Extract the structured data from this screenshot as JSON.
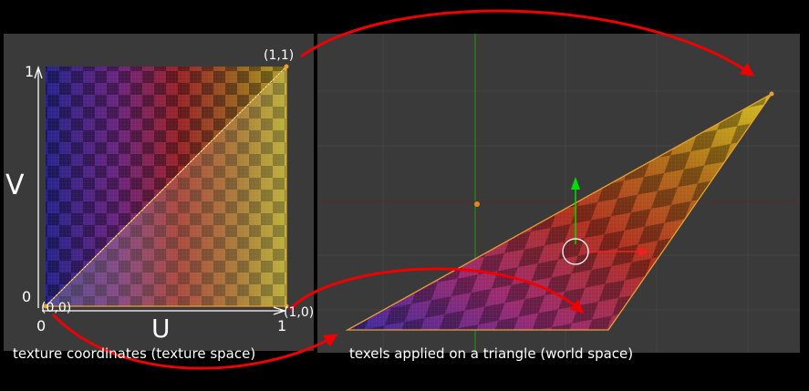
{
  "left_panel": {
    "axis_v_label": "V",
    "axis_u_label": "U",
    "tick_v_top": "1",
    "tick_v_bottom": "0",
    "tick_u_left": "0",
    "tick_u_right": "1",
    "coord_origin": "(0,0)",
    "coord_top_right": "(1,1)",
    "coord_bottom_right": "(1,0)",
    "caption": "texture coordinates (texture space)"
  },
  "right_panel": {
    "caption": "texels applied on a triangle (world space)"
  },
  "colors": {
    "background": "#000000",
    "viewport": "#3a3a3a",
    "grid": "#444444",
    "arrow": "#ee0000",
    "triangle_edge": "#e8a030",
    "gizmo_y": "#00dd00",
    "gizmo_x": "#ee2222",
    "green_axis": "#1f8a1f",
    "red_axis": "#7a2a2a"
  },
  "icons": [
    "curved-arrow",
    "transform-gizmo",
    "origin-dot"
  ]
}
